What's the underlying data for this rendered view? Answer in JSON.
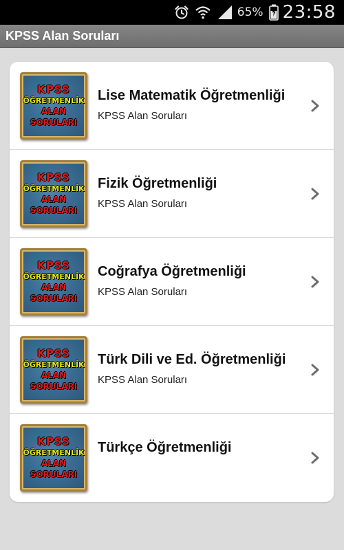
{
  "status_bar": {
    "battery_percent": "65%",
    "time": "23:58",
    "icons": [
      "alarm-clock-icon",
      "wifi-icon",
      "cellular-signal-icon",
      "battery-charging-icon"
    ]
  },
  "app_bar": {
    "title": "KPSS Alan Soruları"
  },
  "thumbnail": {
    "line1": "KPSS",
    "line2": "ÖĞRETMENLİK",
    "line3": "ALAN",
    "line4": "SORULARI",
    "colors": {
      "background": "#3a6c93",
      "frame": "#a27f3c",
      "red_text": "#e01818",
      "yellow_text": "#e6e622"
    }
  },
  "list": {
    "items": [
      {
        "title": "Lise Matematik Öğretmenliği",
        "subtitle": "KPSS Alan Soruları"
      },
      {
        "title": "Fizik Öğretmenliği",
        "subtitle": "KPSS Alan Soruları"
      },
      {
        "title": "Coğrafya Öğretmenliği",
        "subtitle": "KPSS Alan Soruları"
      },
      {
        "title": "Türk Dili ve Ed. Öğretmenliği",
        "subtitle": "KPSS Alan Soruları"
      },
      {
        "title": "Türkçe Öğretmenliği",
        "subtitle": ""
      }
    ],
    "chevron_icon": "chevron-right-icon"
  }
}
